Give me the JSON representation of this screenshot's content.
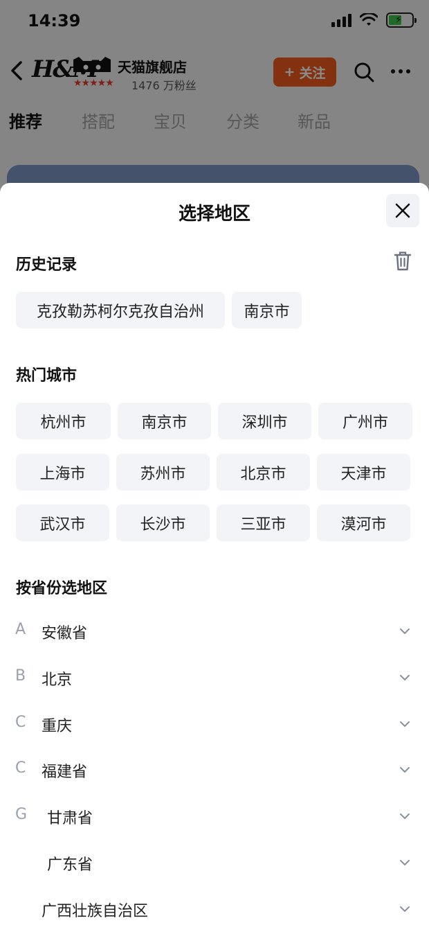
{
  "status_bar": {
    "time": "14:39"
  },
  "store": {
    "logo_text": "H&M",
    "name": "天猫旗舰店",
    "stars": "★★★★★",
    "fans": "1476 万粉丝",
    "follow_label": "关注",
    "follow_plus": "+",
    "tabs": [
      "推荐",
      "搭配",
      "宝贝",
      "分类",
      "新品"
    ]
  },
  "sheet": {
    "title": "选择地区",
    "history": {
      "title": "历史记录",
      "items": [
        "克孜勒苏柯尔克孜自治州",
        "南京市"
      ]
    },
    "hot": {
      "title": "热门城市",
      "cities": [
        "杭州市",
        "南京市",
        "深圳市",
        "广州市",
        "上海市",
        "苏州市",
        "北京市",
        "天津市",
        "武汉市",
        "长沙市",
        "三亚市",
        "漠河市"
      ]
    },
    "province": {
      "title": "按省份选地区",
      "rows": [
        {
          "letter": "A",
          "name": "安徽省"
        },
        {
          "letter": "B",
          "name": "北京"
        },
        {
          "letter": "C",
          "name": "重庆"
        },
        {
          "letter": "C",
          "name": "福建省"
        },
        {
          "letter": "G",
          "name": "甘肃省"
        },
        {
          "letter": "",
          "name": "广东省"
        },
        {
          "letter": "",
          "name": "广西壮族自治区"
        }
      ]
    }
  },
  "colors": {
    "accent": "#f05a1e",
    "chip_bg": "#f3f4f7",
    "tmall_red": "#e23b2e"
  }
}
